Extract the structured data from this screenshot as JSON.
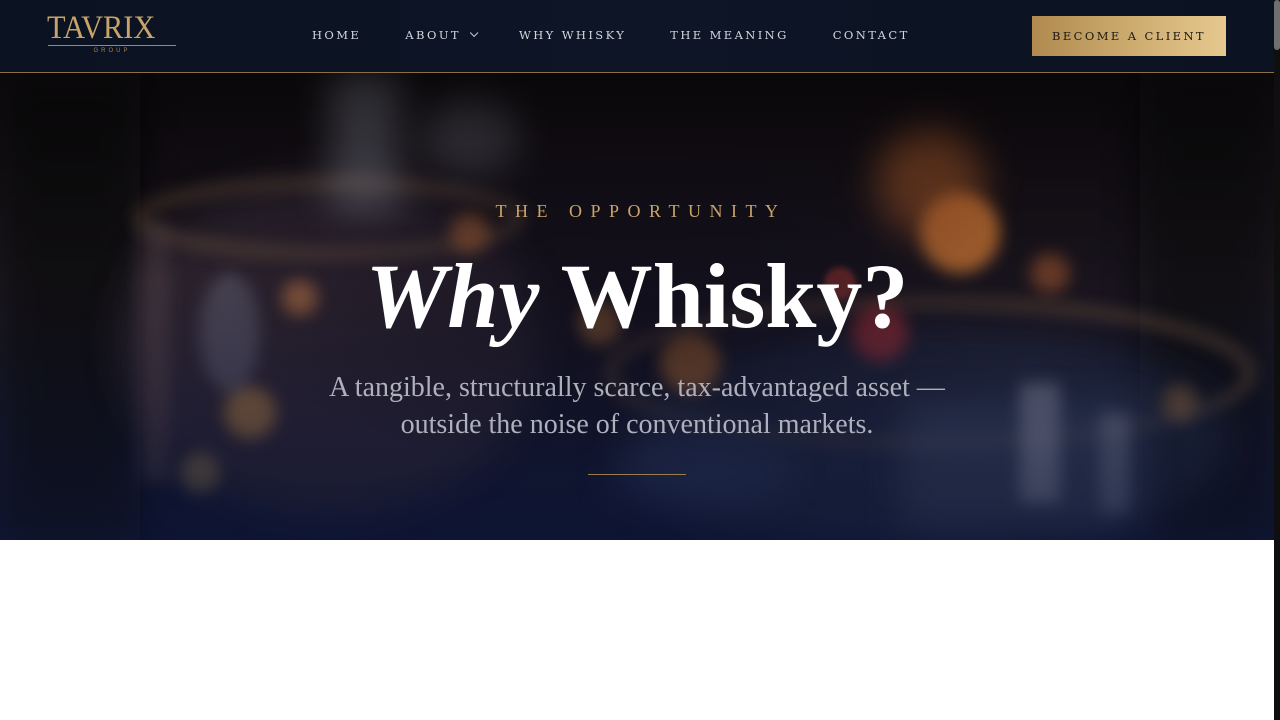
{
  "header": {
    "logo": {
      "name": "TAVRIX",
      "sub": "GROUP"
    },
    "nav": [
      {
        "label": "HOME"
      },
      {
        "label": "ABOUT",
        "has_dropdown": true
      },
      {
        "label": "WHY WHISKY"
      },
      {
        "label": "THE MEANING"
      },
      {
        "label": "CONTACT"
      }
    ],
    "cta_label": "BECOME A CLIENT"
  },
  "hero": {
    "eyebrow": "THE OPPORTUNITY",
    "title_italic": "Why",
    "title_rest": " Whisky?",
    "subtitle": "A tangible, structurally scarce, tax-advantaged asset — outside the noise of conventional markets."
  },
  "colors": {
    "header_bg": "#0b1322",
    "gold": "#c9a46a",
    "cta_gradient_start": "#b08a4e",
    "cta_gradient_end": "#e6c88e",
    "hero_text": "#ffffff",
    "subtitle_text": "#aeb0bc"
  },
  "icons": {
    "about_dropdown": "chevron-down-icon"
  }
}
